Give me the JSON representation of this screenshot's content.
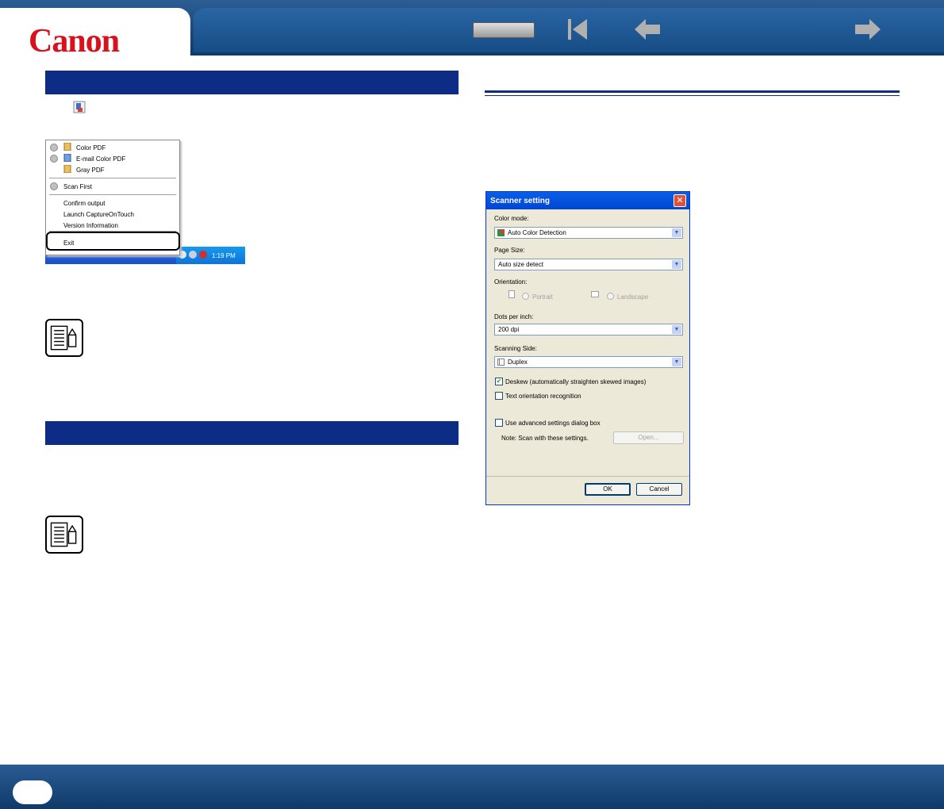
{
  "brand": {
    "logo_text": "Canon",
    "logo_color": "#d8121c",
    "theme_color": "#0d2c86"
  },
  "header": {
    "icons": [
      "top-icon",
      "first-page-icon",
      "back-icon",
      "next-icon"
    ]
  },
  "tray_menu": {
    "items": [
      "Color PDF",
      "E-mail Color PDF",
      "Gray PDF",
      "Scan First",
      "Confirm output",
      "Launch CaptureOnTouch",
      "Version Information",
      "Exit"
    ],
    "clock": "1:19 PM"
  },
  "dialog": {
    "title": "Scanner setting",
    "color_mode": {
      "label": "Color mode:",
      "value": "Auto Color Detection"
    },
    "page_size": {
      "label": "Page Size:",
      "value": "Auto size detect"
    },
    "orientation": {
      "label": "Orientation:",
      "portrait": "Portrait",
      "landscape": "Landscape"
    },
    "dpi": {
      "label": "Dots per inch:",
      "value": "200 dpi"
    },
    "scanning_side": {
      "label": "Scanning Side:",
      "value": "Duplex"
    },
    "deskew": "Deskew (automatically straighten skewed images)",
    "text_orientation": "Text orientation recognition",
    "advanced": "Use advanced settings dialog box",
    "note": "Note: Scan with these settings.",
    "open_button": "Open...",
    "ok_button": "OK",
    "cancel_button": "Cancel"
  }
}
